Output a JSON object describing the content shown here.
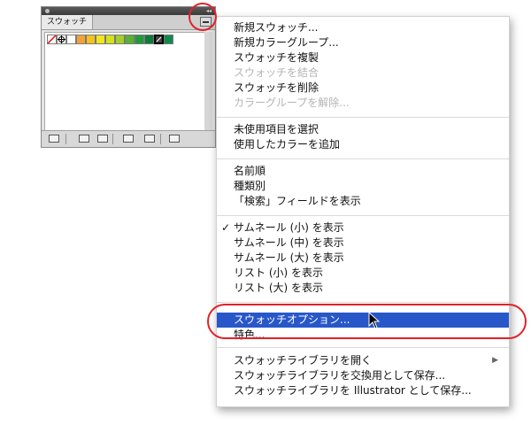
{
  "panel": {
    "tab_label": "スウォッチ",
    "swatch_colors": [
      "#ff0000",
      "#ffffff",
      "#222222",
      "#ffffff",
      "#f3a23a",
      "#f4c21f",
      "#f3e51b",
      "#d4e21b",
      "#a6cf2a",
      "#57b233",
      "#1e9a3d",
      "#0f7a3a",
      "#444444",
      "#0f8a4e"
    ],
    "bottom_icons": [
      "library-menu-icon",
      "show-kinds-icon",
      "swatch-options-icon",
      "new-color-group-icon",
      "new-swatch-icon",
      "delete-swatch-icon"
    ]
  },
  "menu": {
    "items": [
      {
        "label": "新規スウォッチ...",
        "disabled": false
      },
      {
        "label": "新規カラーグループ...",
        "disabled": false
      },
      {
        "label": "スウォッチを複製",
        "disabled": false
      },
      {
        "label": "スウォッチを結合",
        "disabled": true
      },
      {
        "label": "スウォッチを削除",
        "disabled": false
      },
      {
        "label": "カラーグループを解除...",
        "disabled": true
      },
      {
        "label": "未使用項目を選択",
        "disabled": false
      },
      {
        "label": "使用したカラーを追加",
        "disabled": false
      },
      {
        "label": "名前順",
        "disabled": false
      },
      {
        "label": "種類別",
        "disabled": false
      },
      {
        "label": "「検索」フィールドを表示",
        "disabled": false
      },
      {
        "label": "サムネール (小) を表示",
        "disabled": false,
        "checked": true,
        "check": "✓"
      },
      {
        "label": "サムネール (中) を表示",
        "disabled": false
      },
      {
        "label": "サムネール (大) を表示",
        "disabled": false
      },
      {
        "label": "リスト (小) を表示",
        "disabled": false
      },
      {
        "label": "リスト (大) を表示",
        "disabled": false
      },
      {
        "label": "スウォッチオプション...",
        "disabled": false,
        "highlighted": true
      },
      {
        "label": "特色...",
        "disabled": false
      },
      {
        "label": "スウォッチライブラリを開く",
        "disabled": false,
        "submenu": true,
        "arrow": "▶"
      },
      {
        "label": "スウォッチライブラリを交換用として保存...",
        "disabled": false
      },
      {
        "label": "スウォッチライブラリを Illustrator として保存...",
        "disabled": false
      }
    ],
    "highlight_color": "#2857c9"
  },
  "annotation_color": "#e2222a"
}
